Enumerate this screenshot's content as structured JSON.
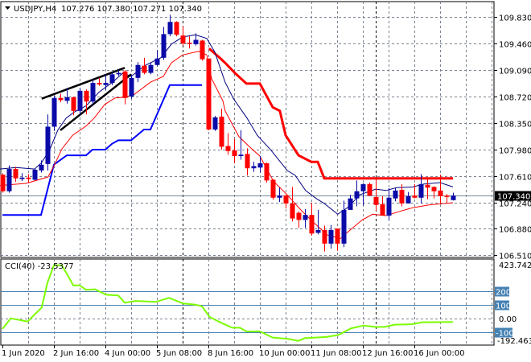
{
  "header": {
    "symbol": "USDJPY,H4",
    "ohlc": "107.276 107.380 107.271 107.340",
    "dropdown_icon": "triangle-down-icon"
  },
  "chart_data": [
    {
      "type": "candlestick",
      "title": "USDJPY,H4",
      "ylim": [
        106.51,
        109.83
      ],
      "y_ticks": [
        "109.830",
        "109.460",
        "109.090",
        "108.720",
        "108.350",
        "107.980",
        "107.610",
        "107.240",
        "106.880",
        "106.510"
      ],
      "current_price": "107.340",
      "grid": true,
      "colors": {
        "bull": "#0a0aa8",
        "bear": "#ff0000",
        "grid": "#7a8290",
        "channel_low": "#0000ff",
        "channel_high": "#ff0000",
        "ma_fast": "#000080",
        "ma_slow": "#ff0000",
        "trendline": "#000000"
      },
      "x_labels": [
        {
          "label": "1 Jun 2020",
          "index": 0
        },
        {
          "label": "2 Jun 16:00",
          "index": 8
        },
        {
          "label": "4 Jun 00:00",
          "index": 16
        },
        {
          "label": "5 Jun 08:00",
          "index": 24
        },
        {
          "label": "8 Jun 16:00",
          "index": 32
        },
        {
          "label": "10 Jun 00:00",
          "index": 40
        },
        {
          "label": "11 Jun 08:00",
          "index": 48
        },
        {
          "label": "12 Jun 16:00",
          "index": 56
        },
        {
          "label": "16 Jun 00:00",
          "index": 64
        }
      ],
      "period_separators": [
        28,
        58
      ],
      "candles_ohlc": [
        [
          107.63,
          107.65,
          107.38,
          107.4
        ],
        [
          107.4,
          107.76,
          107.38,
          107.71
        ],
        [
          107.71,
          107.74,
          107.53,
          107.58
        ],
        [
          107.57,
          107.65,
          107.54,
          107.59
        ],
        [
          107.59,
          107.64,
          107.52,
          107.57
        ],
        [
          107.56,
          107.72,
          107.55,
          107.7
        ],
        [
          107.69,
          107.83,
          107.66,
          107.77
        ],
        [
          107.78,
          108.47,
          107.69,
          108.3
        ],
        [
          108.3,
          108.73,
          108.24,
          108.7
        ],
        [
          108.7,
          108.76,
          108.64,
          108.67
        ],
        [
          108.66,
          108.84,
          108.62,
          108.71
        ],
        [
          108.71,
          108.72,
          108.46,
          108.52
        ],
        [
          108.52,
          108.84,
          108.47,
          108.8
        ],
        [
          108.8,
          108.82,
          108.47,
          108.65
        ],
        [
          108.65,
          108.97,
          108.6,
          108.91
        ],
        [
          108.91,
          108.98,
          108.87,
          108.89
        ],
        [
          108.88,
          109.03,
          108.81,
          108.91
        ],
        [
          108.91,
          109.06,
          108.88,
          109.03
        ],
        [
          109.03,
          109.09,
          109.01,
          109.05
        ],
        [
          109.07,
          109.09,
          108.61,
          108.7
        ],
        [
          108.72,
          109.02,
          108.69,
          108.98
        ],
        [
          108.98,
          109.2,
          108.92,
          109.16
        ],
        [
          109.15,
          109.26,
          109.03,
          109.05
        ],
        [
          109.05,
          109.19,
          109.03,
          109.16
        ],
        [
          109.16,
          109.37,
          109.14,
          109.25
        ],
        [
          109.26,
          109.69,
          109.23,
          109.59
        ],
        [
          109.59,
          109.86,
          109.56,
          109.76
        ],
        [
          109.76,
          109.77,
          109.56,
          109.58
        ],
        [
          109.57,
          109.7,
          109.43,
          109.46
        ],
        [
          109.47,
          109.56,
          109.39,
          109.46
        ],
        [
          109.45,
          109.6,
          109.43,
          109.51
        ],
        [
          109.5,
          109.51,
          109.22,
          109.24
        ],
        [
          109.25,
          109.25,
          108.25,
          108.26
        ],
        [
          108.26,
          108.45,
          108.24,
          108.43
        ],
        [
          108.44,
          108.55,
          107.98,
          108.02
        ],
        [
          108.03,
          108.21,
          107.91,
          107.96
        ],
        [
          107.97,
          108.13,
          107.79,
          107.89
        ],
        [
          107.89,
          108.25,
          107.84,
          107.91
        ],
        [
          107.92,
          108.0,
          107.62,
          107.72
        ],
        [
          107.72,
          107.81,
          107.67,
          107.75
        ],
        [
          107.73,
          107.89,
          107.66,
          107.79
        ],
        [
          107.79,
          107.8,
          107.52,
          107.55
        ],
        [
          107.56,
          107.57,
          107.28,
          107.31
        ],
        [
          107.31,
          107.45,
          107.25,
          107.34
        ],
        [
          107.34,
          107.35,
          107.16,
          107.23
        ],
        [
          107.23,
          107.46,
          106.98,
          107.02
        ],
        [
          107.1,
          107.12,
          106.89,
          107.0
        ],
        [
          107.0,
          107.15,
          106.89,
          107.07
        ],
        [
          107.07,
          107.24,
          106.78,
          106.81
        ],
        [
          106.82,
          107.14,
          106.8,
          106.86
        ],
        [
          106.86,
          106.92,
          106.56,
          106.67
        ],
        [
          106.67,
          106.93,
          106.6,
          106.86
        ],
        [
          106.88,
          106.88,
          106.57,
          106.67
        ],
        [
          106.67,
          107.27,
          106.62,
          107.14
        ],
        [
          107.14,
          107.35,
          107.14,
          107.3
        ],
        [
          107.3,
          107.55,
          107.19,
          107.4
        ],
        [
          107.4,
          107.51,
          107.2,
          107.5
        ],
        [
          107.5,
          107.52,
          107.33,
          107.34
        ],
        [
          107.32,
          107.58,
          107.13,
          107.21
        ],
        [
          107.22,
          107.33,
          107.06,
          107.06
        ],
        [
          107.06,
          107.44,
          107.0,
          107.31
        ],
        [
          107.3,
          107.45,
          107.26,
          107.41
        ],
        [
          107.42,
          107.5,
          107.19,
          107.23
        ],
        [
          107.23,
          107.39,
          107.23,
          107.33
        ],
        [
          107.34,
          107.5,
          107.3,
          107.31
        ],
        [
          107.31,
          107.64,
          107.23,
          107.5
        ],
        [
          107.49,
          107.57,
          107.29,
          107.45
        ],
        [
          107.46,
          107.47,
          107.3,
          107.4
        ],
        [
          107.41,
          107.63,
          107.23,
          107.33
        ],
        [
          107.34,
          107.36,
          107.24,
          107.32
        ],
        [
          107.276,
          107.38,
          107.271,
          107.34
        ]
      ],
      "overlays": [
        {
          "name": "channel-low",
          "style": "step",
          "points": [
            [
              0,
              107.07
            ],
            [
              6,
              107.07
            ],
            [
              8,
              107.77
            ],
            [
              10,
              107.9
            ],
            [
              13,
              107.9
            ],
            [
              14,
              107.98
            ],
            [
              16,
              107.98
            ],
            [
              17,
              108.06
            ],
            [
              18,
              108.11
            ],
            [
              20,
              108.11
            ],
            [
              22,
              108.26
            ],
            [
              23,
              108.26
            ],
            [
              26,
              108.88
            ],
            [
              31,
              108.88
            ]
          ]
        },
        {
          "name": "channel-high",
          "style": "step",
          "points": [
            [
              32.1,
              109.39
            ],
            [
              33.75,
              109.26
            ],
            [
              34.6,
              109.19
            ],
            [
              36.1,
              109.05
            ],
            [
              37.9,
              108.9
            ],
            [
              40,
              108.9
            ],
            [
              42,
              108.57
            ],
            [
              43.1,
              108.52
            ],
            [
              44,
              108.18
            ],
            [
              46,
              107.9
            ],
            [
              48,
              107.81
            ],
            [
              49,
              107.81
            ],
            [
              50,
              107.58
            ],
            [
              70,
              107.58
            ]
          ]
        },
        {
          "name": "ma-fast",
          "style": "thin",
          "points": [
            [
              -0.4,
              107.71
            ],
            [
              2.1,
              107.73
            ],
            [
              5,
              107.71
            ],
            [
              6.1,
              107.8
            ],
            [
              7.4,
              107.99
            ],
            [
              8.6,
              108.25
            ],
            [
              9.9,
              108.42
            ],
            [
              11.1,
              108.5
            ],
            [
              13,
              108.59
            ],
            [
              15,
              108.78
            ],
            [
              17.1,
              108.92
            ],
            [
              18.75,
              109.05
            ],
            [
              20,
              109.0
            ],
            [
              22.1,
              109.15
            ],
            [
              24.6,
              109.26
            ],
            [
              26.25,
              109.45
            ],
            [
              28,
              109.55
            ],
            [
              30,
              109.58
            ],
            [
              31.75,
              109.53
            ],
            [
              33,
              109.34
            ],
            [
              34.6,
              108.92
            ],
            [
              35.9,
              108.69
            ],
            [
              38,
              108.42
            ],
            [
              39.6,
              108.18
            ],
            [
              41.75,
              107.97
            ],
            [
              44.25,
              107.69
            ],
            [
              45.5,
              107.62
            ],
            [
              47.1,
              107.41
            ],
            [
              48.75,
              107.3
            ],
            [
              50,
              107.23
            ],
            [
              52.1,
              107.08
            ],
            [
              53.75,
              107.18
            ],
            [
              55.5,
              107.35
            ],
            [
              58,
              107.43
            ],
            [
              59.6,
              107.41
            ],
            [
              61.25,
              107.45
            ],
            [
              63.75,
              107.46
            ],
            [
              65.5,
              107.5
            ],
            [
              68,
              107.52
            ],
            [
              70,
              107.46
            ]
          ]
        },
        {
          "name": "ma-slow",
          "style": "thin",
          "points": [
            [
              -0.4,
              107.48
            ],
            [
              3.75,
              107.51
            ],
            [
              7.1,
              107.6
            ],
            [
              8.1,
              107.77
            ],
            [
              9.25,
              107.99
            ],
            [
              10.9,
              108.18
            ],
            [
              13,
              108.31
            ],
            [
              14.25,
              108.42
            ],
            [
              15.9,
              108.61
            ],
            [
              17.5,
              108.7
            ],
            [
              19,
              108.71
            ],
            [
              20.5,
              108.75
            ],
            [
              23,
              108.92
            ],
            [
              25,
              109.0
            ],
            [
              26.25,
              109.19
            ],
            [
              28,
              109.3
            ],
            [
              30.5,
              109.35
            ],
            [
              31.75,
              109.3
            ],
            [
              32.5,
              108.97
            ],
            [
              34.25,
              108.66
            ],
            [
              34.6,
              108.52
            ],
            [
              36.75,
              108.16
            ],
            [
              38.75,
              107.99
            ],
            [
              40,
              107.89
            ],
            [
              42.1,
              107.54
            ],
            [
              44.25,
              107.35
            ],
            [
              46.25,
              107.15
            ],
            [
              48.4,
              106.96
            ],
            [
              50.5,
              106.79
            ],
            [
              52.5,
              106.74
            ],
            [
              53.75,
              106.84
            ],
            [
              55.9,
              107.0
            ],
            [
              57.5,
              107.08
            ],
            [
              59.6,
              107.06
            ],
            [
              61.75,
              107.12
            ],
            [
              63.75,
              107.17
            ],
            [
              66.25,
              107.21
            ],
            [
              70,
              107.24
            ]
          ]
        }
      ],
      "trendlines": [
        {
          "name": "wedge-upper",
          "from": [
            6.1,
            108.69
          ],
          "to": [
            19,
            109.12
          ]
        },
        {
          "name": "wedge-lower",
          "from": [
            9,
            108.25
          ],
          "to": [
            20,
            109.03
          ]
        }
      ]
    },
    {
      "type": "line",
      "title": "CCI(40) -23.5377",
      "ylim": [
        -192.4639,
        423.7426
      ],
      "y_max_label": "423.7426",
      "y_min_label": "-192.4639",
      "zero_label": "0.00",
      "levels": [
        {
          "value": 200,
          "label": "200"
        },
        {
          "value": 100,
          "label": "100"
        },
        {
          "value": -100,
          "label": "-100"
        }
      ],
      "colors": {
        "line": "#7cfc00",
        "level": "#4682b4"
      },
      "points": [
        [
          0,
          -76
        ],
        [
          1.3,
          2
        ],
        [
          3.9,
          -22
        ],
        [
          6.1,
          80
        ],
        [
          7,
          263
        ],
        [
          8,
          390
        ],
        [
          9.2,
          390
        ],
        [
          10.1,
          321
        ],
        [
          11,
          243
        ],
        [
          12,
          243
        ],
        [
          13,
          210
        ],
        [
          14.4,
          214
        ],
        [
          16.1,
          174
        ],
        [
          18,
          169
        ],
        [
          19,
          116
        ],
        [
          20.7,
          129
        ],
        [
          23.8,
          122
        ],
        [
          25.9,
          151
        ],
        [
          28.1,
          110
        ],
        [
          30,
          102
        ],
        [
          31,
          90
        ],
        [
          32.2,
          12
        ],
        [
          34,
          -31
        ],
        [
          35.7,
          -67
        ],
        [
          36.9,
          -67
        ],
        [
          37.9,
          -94
        ],
        [
          40,
          -94
        ],
        [
          42,
          -139
        ],
        [
          44.4,
          -149
        ],
        [
          46,
          -163
        ],
        [
          47,
          -143
        ],
        [
          50.3,
          -135
        ],
        [
          52.2,
          -120
        ],
        [
          54.2,
          -71
        ],
        [
          56.1,
          -51
        ],
        [
          58,
          -61
        ],
        [
          59.4,
          -61
        ],
        [
          60.9,
          -45
        ],
        [
          63.7,
          -41
        ],
        [
          65.2,
          -27
        ],
        [
          70,
          -25
        ]
      ]
    }
  ]
}
